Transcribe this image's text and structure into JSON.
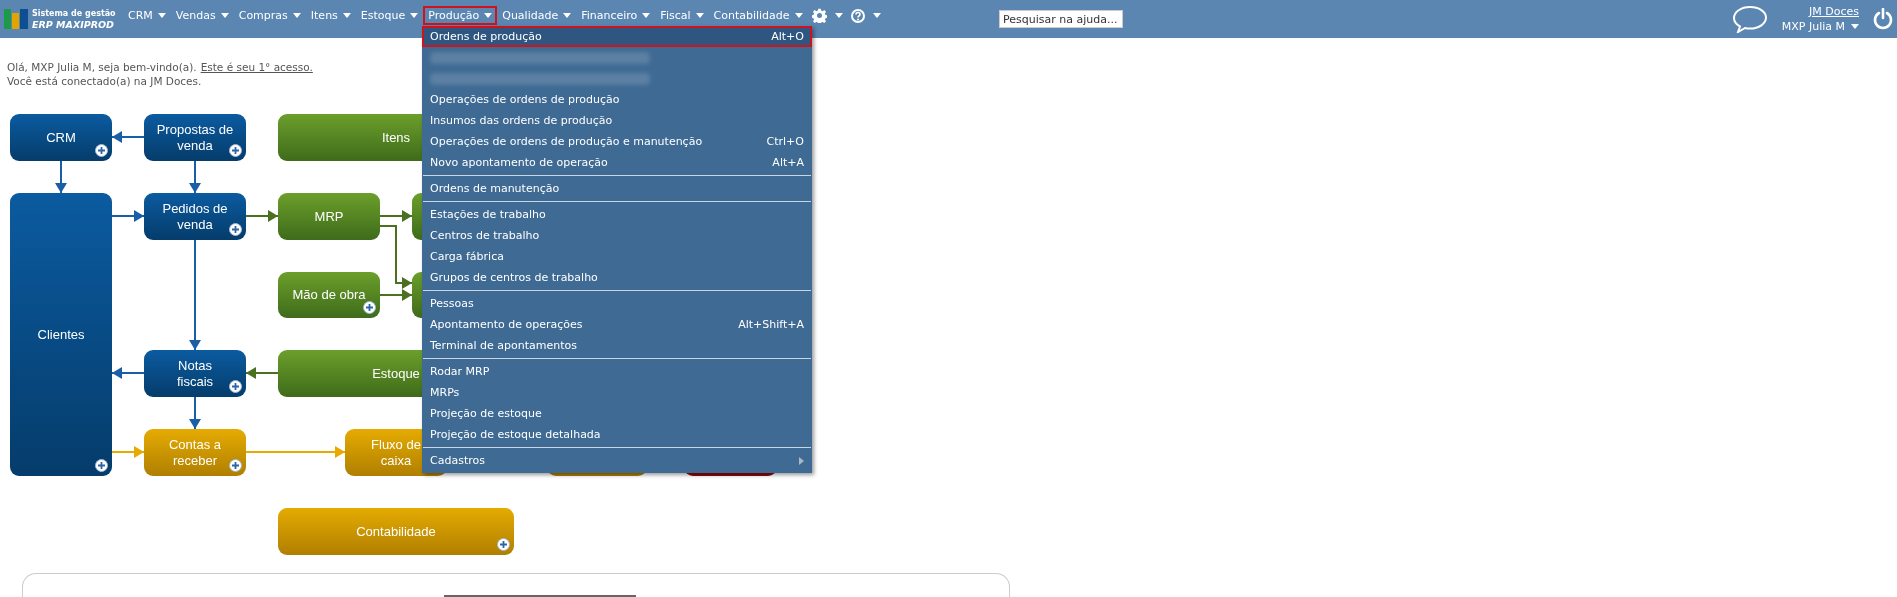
{
  "logo": {
    "line1": "Sistema de gestão",
    "line2": "ERP MAXIPROD"
  },
  "nav": [
    {
      "label": "CRM",
      "selected": false
    },
    {
      "label": "Vendas",
      "selected": false
    },
    {
      "label": "Compras",
      "selected": false
    },
    {
      "label": "Itens",
      "selected": false
    },
    {
      "label": "Estoque",
      "selected": false
    },
    {
      "label": "Produção",
      "selected": true
    },
    {
      "label": "Qualidade",
      "selected": false
    },
    {
      "label": "Financeiro",
      "selected": false
    },
    {
      "label": "Fiscal",
      "selected": false
    },
    {
      "label": "Contabilidade",
      "selected": false
    }
  ],
  "help_search": {
    "placeholder": "Pesquisar na ajuda..."
  },
  "user": {
    "company": "JM Doces",
    "name": "MXP Julia M"
  },
  "welcome": {
    "greeting": "Olá, MXP Julia M, seja bem-vindo(a).",
    "link": "Este é seu 1° acesso.",
    "connected": "Você está conectado(a) na JM Doces."
  },
  "diagram": {
    "nodes": [
      {
        "label": "CRM",
        "kind": "sales",
        "add_button": true
      },
      {
        "label": "Propostas de venda",
        "kind": "sales",
        "add_button": true
      },
      {
        "label": "Itens",
        "kind": "production"
      },
      {
        "label": "Clientes",
        "kind": "sales",
        "add_button": true
      },
      {
        "label": "Pedidos de venda",
        "kind": "sales",
        "add_button": true
      },
      {
        "label": "MRP",
        "kind": "production",
        "add_button": false
      },
      {
        "kind": "production"
      },
      {
        "label": "Mão de obra",
        "kind": "production",
        "add_button": true
      },
      {
        "kind": "production"
      },
      {
        "label": "Notas fiscais",
        "kind": "sales",
        "add_button": true
      },
      {
        "label": "Estoque",
        "kind": "production"
      },
      {
        "label": "Contas a receber",
        "kind": "finance",
        "add_button": true
      },
      {
        "label": "Fluxo de caixa",
        "kind": "finance"
      },
      {
        "kind": "finance"
      },
      {
        "kind": "alert"
      },
      {
        "label": "Contabilidade",
        "kind": "finance",
        "add_button": true
      }
    ]
  },
  "menu": {
    "groups": [
      {
        "items": [
          {
            "kind": "entry",
            "label": "Ordens de produção",
            "shortcut": "Alt+O",
            "selected": true
          },
          {
            "kind": "blurred",
            "selected": false
          },
          {
            "kind": "blurred",
            "selected": false
          },
          {
            "kind": "entry",
            "label": "Operações de ordens de produção",
            "selected": false
          },
          {
            "kind": "entry",
            "label": "Insumos das ordens de produção",
            "selected": false
          },
          {
            "kind": "entry",
            "label": "Operações de ordens de produção e manutenção",
            "shortcut": "Ctrl+O",
            "selected": false
          },
          {
            "kind": "entry",
            "label": "Novo apontamento de operação",
            "shortcut": "Alt+A",
            "selected": false
          }
        ]
      },
      {
        "items": [
          {
            "kind": "entry",
            "label": "Ordens de manutenção",
            "selected": false
          }
        ]
      },
      {
        "items": [
          {
            "kind": "entry",
            "label": "Estações de trabalho",
            "selected": false
          },
          {
            "kind": "entry",
            "label": "Centros de trabalho",
            "selected": false
          },
          {
            "kind": "entry",
            "label": "Carga fábrica",
            "selected": false
          },
          {
            "kind": "entry",
            "label": "Grupos de centros de trabalho",
            "selected": false
          }
        ]
      },
      {
        "items": [
          {
            "kind": "entry",
            "label": "Pessoas",
            "selected": false
          },
          {
            "kind": "entry",
            "label": "Apontamento de operações",
            "shortcut": "Alt+Shift+A",
            "selected": false
          },
          {
            "kind": "entry",
            "label": "Terminal de apontamentos",
            "selected": false
          }
        ]
      },
      {
        "items": [
          {
            "kind": "entry",
            "label": "Rodar MRP",
            "selected": false
          },
          {
            "kind": "entry",
            "label": "MRPs",
            "selected": false
          },
          {
            "kind": "entry",
            "label": "Projeção de estoque",
            "selected": false
          },
          {
            "kind": "entry",
            "label": "Projeção de estoque detalhada",
            "selected": false
          }
        ]
      },
      {
        "items": [
          {
            "kind": "submenu",
            "label": "Cadastros",
            "selected": false
          }
        ]
      }
    ]
  }
}
